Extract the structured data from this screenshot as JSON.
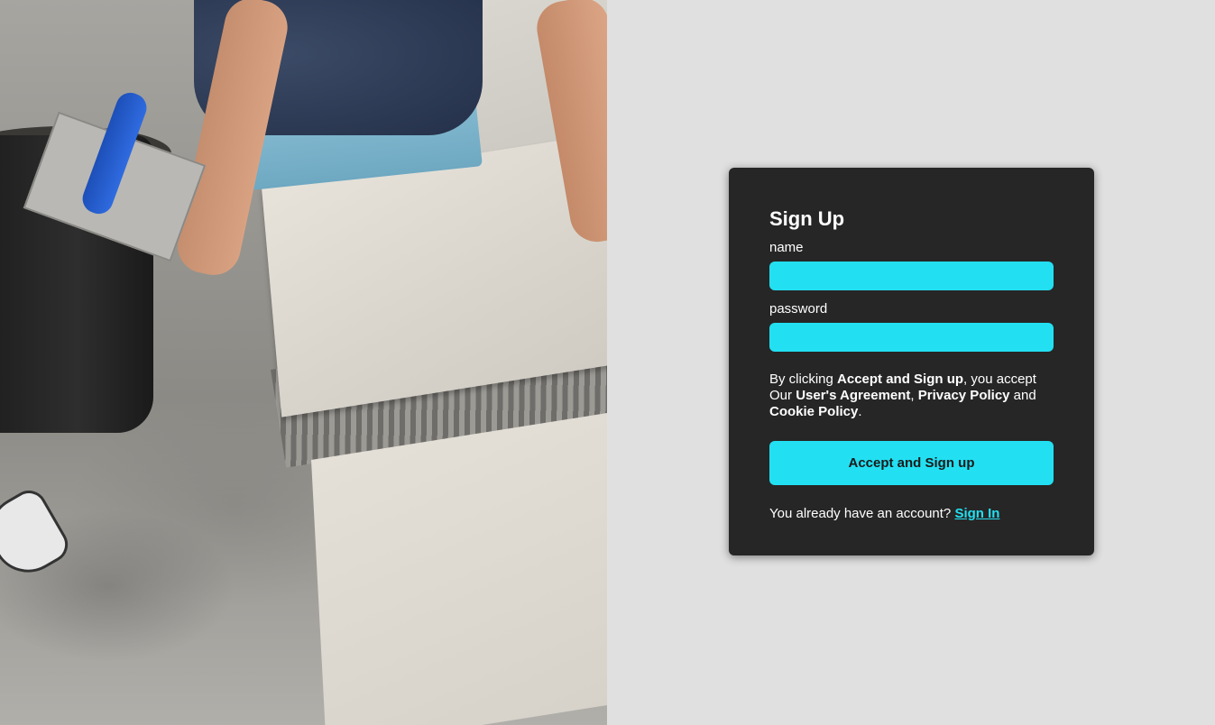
{
  "hero": {
    "image_description": "worker-laying-floor-tiles"
  },
  "signup": {
    "title": "Sign Up",
    "name_label": "name",
    "name_value": "",
    "password_label": "password",
    "password_value": "",
    "terms": {
      "prefix": "By clicking ",
      "action_name": "Accept and Sign up",
      "middle": ", you accept Our ",
      "users_agreement": "User's Agreement",
      "comma": ", ",
      "privacy_policy": "Privacy Policy",
      "and": " and ",
      "cookie_policy": "Cookie Policy",
      "period": "."
    },
    "submit_label": "Accept and Sign up",
    "signin_prompt": "You already have an account? ",
    "signin_link": "Sign In"
  },
  "colors": {
    "accent": "#22e0f2",
    "card_background": "#262626",
    "page_background": "#e0e0e0"
  }
}
